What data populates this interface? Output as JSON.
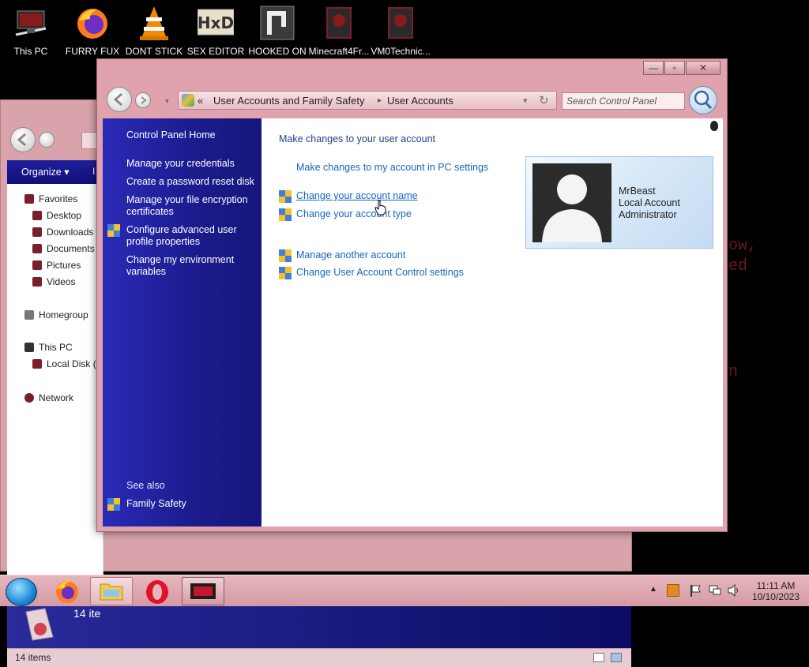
{
  "desktop": {
    "icons": [
      {
        "label": "This PC"
      },
      {
        "label": "FURRY FUX"
      },
      {
        "label": "DONT STICK"
      },
      {
        "label": "SEX EDITOR"
      },
      {
        "label": "HOOKED ON"
      },
      {
        "label": "Minecraft4Fr..."
      },
      {
        "label": "VM0Technic..."
      }
    ],
    "background_text": [
      "ow,",
      "ed",
      "n"
    ]
  },
  "explorer": {
    "organize_label": "Organize",
    "organize_arrow": "▾",
    "toolbar_partial": "I",
    "nav_items": [
      {
        "label": "Favorites"
      },
      {
        "label": "Desktop"
      },
      {
        "label": "Downloads"
      },
      {
        "label": "Documents"
      },
      {
        "label": "Pictures"
      },
      {
        "label": "Videos"
      },
      {
        "label": "Homegroup"
      },
      {
        "label": "This PC"
      },
      {
        "label": "Local Disk (C:"
      },
      {
        "label": "Network"
      }
    ],
    "details_count": "14 ite",
    "status_text": "14 items"
  },
  "control_panel": {
    "caption": {
      "minimize": "—",
      "maximize": "▫",
      "close": "✕"
    },
    "breadcrumb": {
      "prefix": "«",
      "parent": "User Accounts and Family Safety",
      "separator": "▸",
      "current": "User Accounts"
    },
    "search_placeholder": "Search Control Panel",
    "left_links": [
      {
        "label": "Control Panel Home"
      },
      {
        "label": "Manage your credentials"
      },
      {
        "label": "Create a password reset disk"
      },
      {
        "label": "Manage your file encryption certificates"
      },
      {
        "label": "Configure advanced user profile properties"
      },
      {
        "label": "Change my environment variables"
      }
    ],
    "see_also": {
      "heading": "See also",
      "family_safety": "Family Safety"
    },
    "main": {
      "heading": "Make changes to your user account",
      "pc_settings_link": "Make changes to my account in PC settings",
      "change_name": "Change your account name",
      "change_type": "Change your account type",
      "manage_another": "Manage another account",
      "uac_settings": "Change User Account Control settings"
    },
    "user": {
      "name": "MrBeast",
      "account_kind": "Local Account",
      "role": "Administrator"
    }
  },
  "taskbar": {
    "time": "11:11 AM",
    "date": "10/10/2023"
  },
  "colors": {
    "window_frame": "#e0a3ad",
    "sidebar_blue": "#1b1b8c",
    "link_blue": "#1565c0"
  }
}
